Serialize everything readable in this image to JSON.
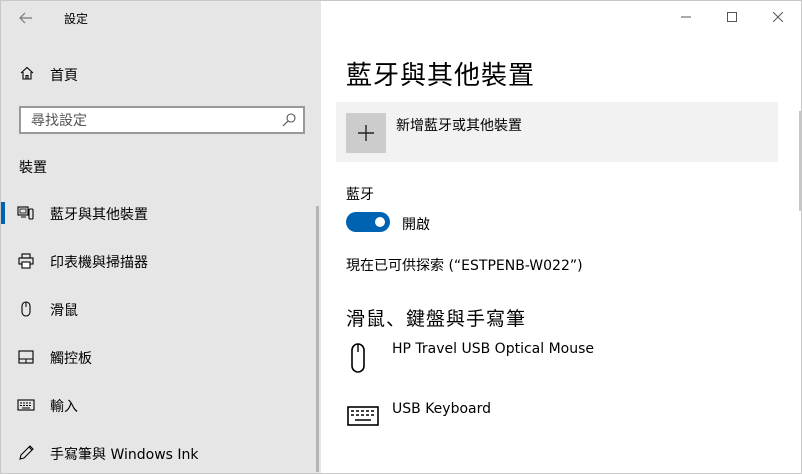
{
  "window": {
    "title": "設定",
    "back_icon": "back-arrow-icon"
  },
  "sidebar": {
    "home_label": "首頁",
    "search_placeholder": "尋找設定",
    "section_title": "裝置",
    "items": [
      {
        "label": "藍牙與其他裝置",
        "icon": "bluetooth-devices-icon",
        "selected": true
      },
      {
        "label": "印表機與掃描器",
        "icon": "printer-icon",
        "selected": false
      },
      {
        "label": "滑鼠",
        "icon": "mouse-icon",
        "selected": false
      },
      {
        "label": "觸控板",
        "icon": "touchpad-icon",
        "selected": false
      },
      {
        "label": "輸入",
        "icon": "keyboard-icon",
        "selected": false
      },
      {
        "label": "手寫筆與 Windows Ink",
        "icon": "pen-icon",
        "selected": false
      }
    ]
  },
  "main": {
    "page_title": "藍牙與其他裝置",
    "add_device_label": "新增藍牙或其他裝置",
    "bluetooth_label": "藍牙",
    "bluetooth_toggle": {
      "state": "開啟",
      "on": true
    },
    "discoverable_text": "現在已可供探索 (“ESTPENB-W022”)",
    "section_title": "滑鼠、鍵盤與手寫筆",
    "devices": [
      {
        "name": "HP Travel USB Optical Mouse",
        "icon": "mouse-icon"
      },
      {
        "name": "USB Keyboard",
        "icon": "keyboard-icon"
      }
    ]
  },
  "colors": {
    "accent": "#0063b1",
    "sidebar_bg": "#e6e6e6",
    "panel_bg": "#f2f2f2"
  }
}
